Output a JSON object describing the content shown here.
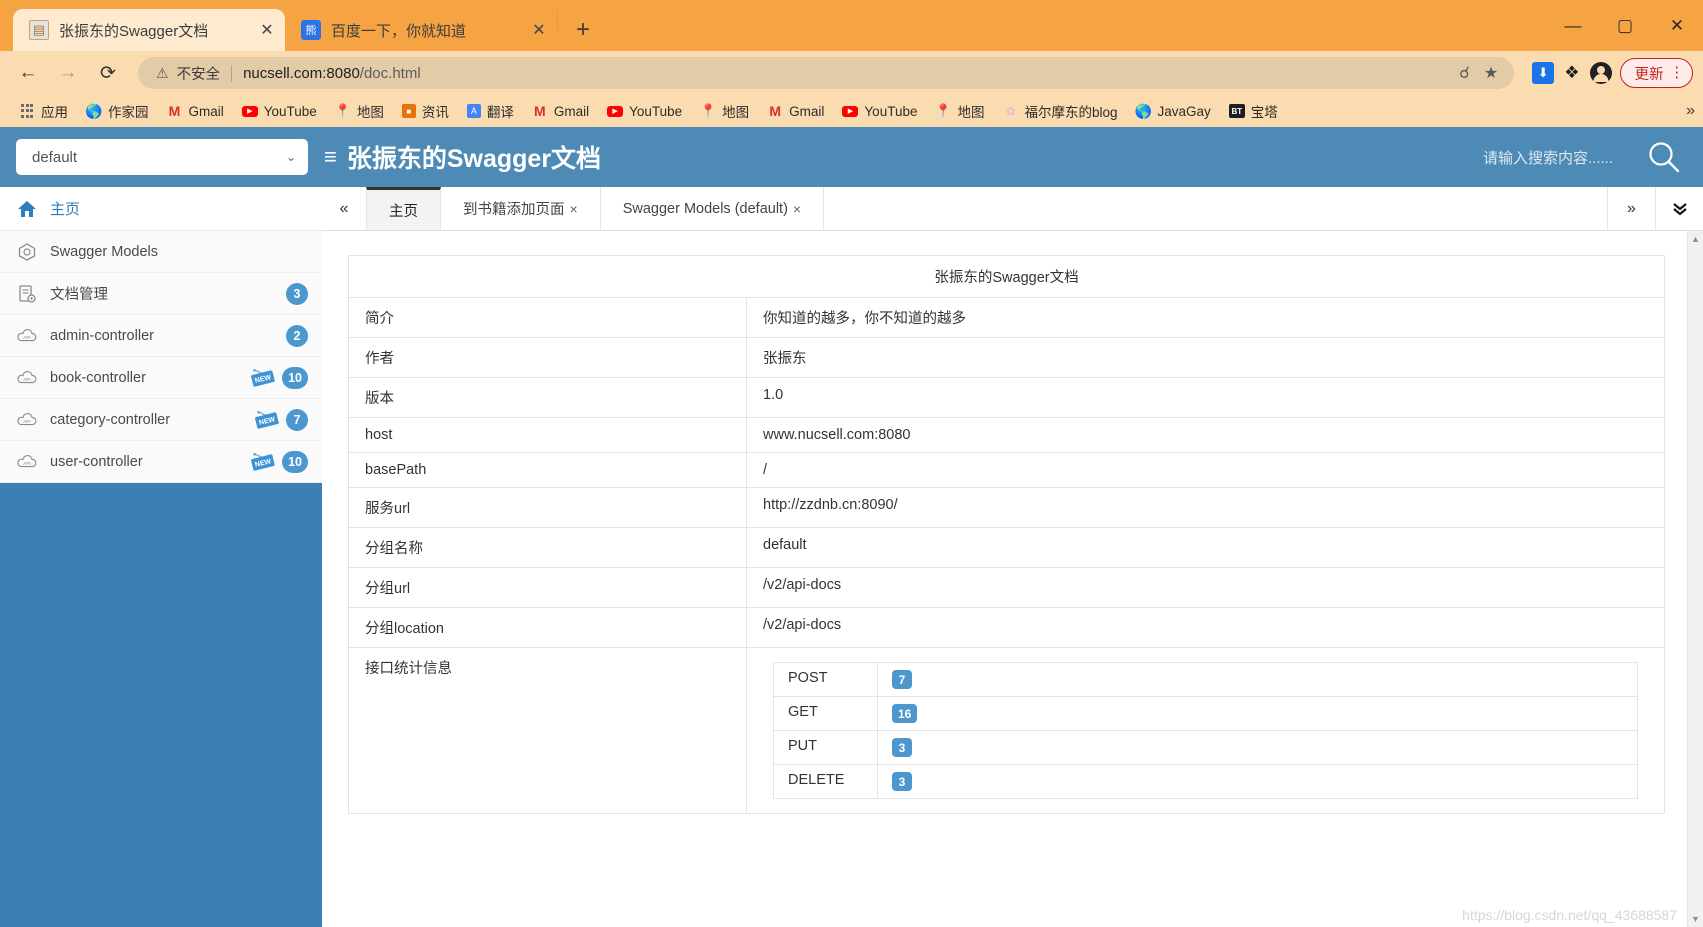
{
  "browser": {
    "tabs": [
      {
        "title": "张振东的Swagger文档",
        "favicon": "document-icon",
        "active": true,
        "close": "✕"
      },
      {
        "title": "百度一下，你就知道",
        "favicon": "baidu-icon",
        "active": false,
        "close": "✕"
      }
    ],
    "new_tab_label": "+",
    "window_controls": {
      "minimize": "—",
      "maximize": "▢",
      "close": "✕"
    },
    "nav": {
      "back": "←",
      "forward": "→",
      "reload": "⟳"
    },
    "omnibox": {
      "warning_icon": "⚠",
      "security_label": "不安全",
      "url_host": "nucsell.com:8080",
      "url_path": "/doc.html",
      "url_full": "nucsell.com:8080/doc.html",
      "zoom_icon": "search-icon",
      "bookmark_icon": "★"
    },
    "toolbar_icons": [
      "download-extension-icon",
      "puzzle-icon",
      "profile-avatar-icon"
    ],
    "update_button": {
      "label": "更新",
      "menu": "⋮"
    },
    "bookmarks": [
      {
        "label": "应用",
        "icon": "apps-grid-icon"
      },
      {
        "label": "作家园",
        "icon": "globe-icon"
      },
      {
        "label": "Gmail",
        "icon": "gmail-icon"
      },
      {
        "label": "YouTube",
        "icon": "youtube-icon"
      },
      {
        "label": "地图",
        "icon": "maps-icon"
      },
      {
        "label": "资讯",
        "icon": "news-icon"
      },
      {
        "label": "翻译",
        "icon": "translate-icon"
      },
      {
        "label": "Gmail",
        "icon": "gmail-icon"
      },
      {
        "label": "YouTube",
        "icon": "youtube-icon"
      },
      {
        "label": "地图",
        "icon": "maps-icon"
      },
      {
        "label": "Gmail",
        "icon": "gmail-icon"
      },
      {
        "label": "YouTube",
        "icon": "youtube-icon"
      },
      {
        "label": "地图",
        "icon": "maps-icon"
      },
      {
        "label": "福尔摩东的blog",
        "icon": "flower-icon"
      },
      {
        "label": "JavaGay",
        "icon": "globe-icon"
      },
      {
        "label": "宝塔",
        "icon": "bt-icon"
      }
    ],
    "bookmarks_overflow": "»"
  },
  "app": {
    "header": {
      "group_select_value": "default",
      "group_select_chevron": "⌄",
      "burger_icon": "≡",
      "title": "张振东的Swagger文档",
      "search_placeholder": "请输入搜索内容......",
      "search_icon": "search-icon"
    },
    "sidebar": {
      "items": [
        {
          "label": "主页",
          "icon": "home-icon",
          "active": true,
          "count": null,
          "new": false
        },
        {
          "label": "Swagger Models",
          "icon": "models-icon",
          "active": false,
          "count": null,
          "new": false
        },
        {
          "label": "文档管理",
          "icon": "document-settings-icon",
          "active": false,
          "count": "3",
          "new": false
        },
        {
          "label": "admin-controller",
          "icon": "api-cloud-icon",
          "active": false,
          "count": "2",
          "new": false
        },
        {
          "label": "book-controller",
          "icon": "api-cloud-icon",
          "active": false,
          "count": "10",
          "new": true
        },
        {
          "label": "category-controller",
          "icon": "api-cloud-icon",
          "active": false,
          "count": "7",
          "new": true
        },
        {
          "label": "user-controller",
          "icon": "api-cloud-icon",
          "active": false,
          "count": "10",
          "new": true
        }
      ],
      "new_tag_label": "NEW"
    },
    "content_tabs": {
      "scroll_left": "«",
      "scroll_right": "»",
      "dropdown": "⌄⌄",
      "tabs": [
        {
          "label": "主页",
          "closable": false,
          "active": true
        },
        {
          "label": "到书籍添加页面",
          "closable": true,
          "active": false
        },
        {
          "label": "Swagger Models (default)",
          "closable": true,
          "active": false
        }
      ],
      "close_glyph": "×"
    },
    "doc": {
      "title": "张振东的Swagger文档",
      "rows": [
        {
          "label": "简介",
          "value": "你知道的越多，你不知道的越多"
        },
        {
          "label": "作者",
          "value": "张振东"
        },
        {
          "label": "版本",
          "value": "1.0"
        },
        {
          "label": "host",
          "value": "www.nucsell.com:8080"
        },
        {
          "label": "basePath",
          "value": "/"
        },
        {
          "label": "服务url",
          "value": "http://zzdnb.cn:8090/"
        },
        {
          "label": "分组名称",
          "value": "default"
        },
        {
          "label": "分组url",
          "value": "/v2/api-docs"
        },
        {
          "label": "分组location",
          "value": "/v2/api-docs"
        }
      ],
      "stats_label": "接口统计信息",
      "stats": [
        {
          "method": "POST",
          "count": "7"
        },
        {
          "method": "GET",
          "count": "16"
        },
        {
          "method": "PUT",
          "count": "3"
        },
        {
          "method": "DELETE",
          "count": "3"
        }
      ]
    },
    "watermark": "https://blog.csdn.net/qq_43688587"
  },
  "colors": {
    "chrome_tabbar": "#f6a443",
    "chrome_toolbar": "#fbdcb0",
    "app_header_blue": "#4d8ab5",
    "sidebar_blue": "#3d7fb3",
    "badge_blue": "#4d97cf",
    "update_red": "#c5221f"
  }
}
